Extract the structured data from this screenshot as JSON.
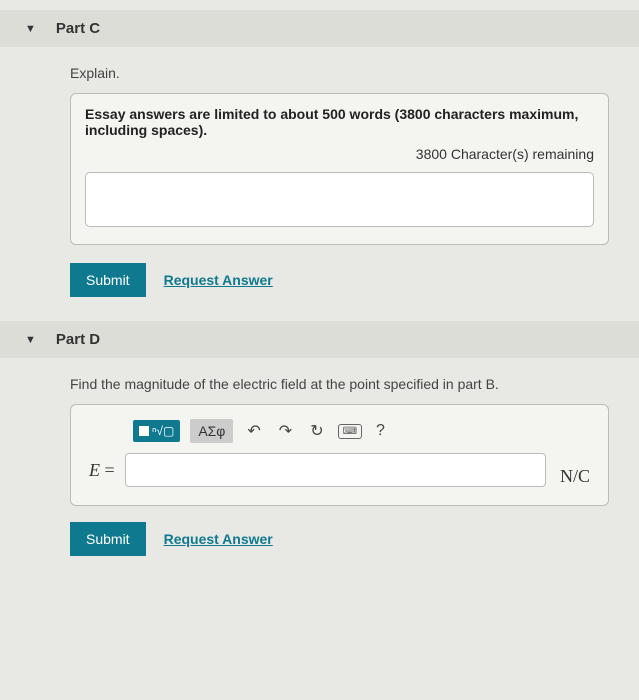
{
  "partC": {
    "title": "Part C",
    "prompt": "Explain.",
    "essayLimit": "Essay answers are limited to about 500 words (3800 characters maximum, including spaces).",
    "charRemaining": "3800 Character(s) remaining",
    "submit": "Submit",
    "requestAnswer": "Request Answer"
  },
  "partD": {
    "title": "Part D",
    "prompt": "Find the magnitude of the electric field at the point specified in part B.",
    "toolbar": {
      "greek": "ΑΣφ",
      "help": "?"
    },
    "variable": "E",
    "equals": "=",
    "unit": "N/C",
    "submit": "Submit",
    "requestAnswer": "Request Answer"
  }
}
